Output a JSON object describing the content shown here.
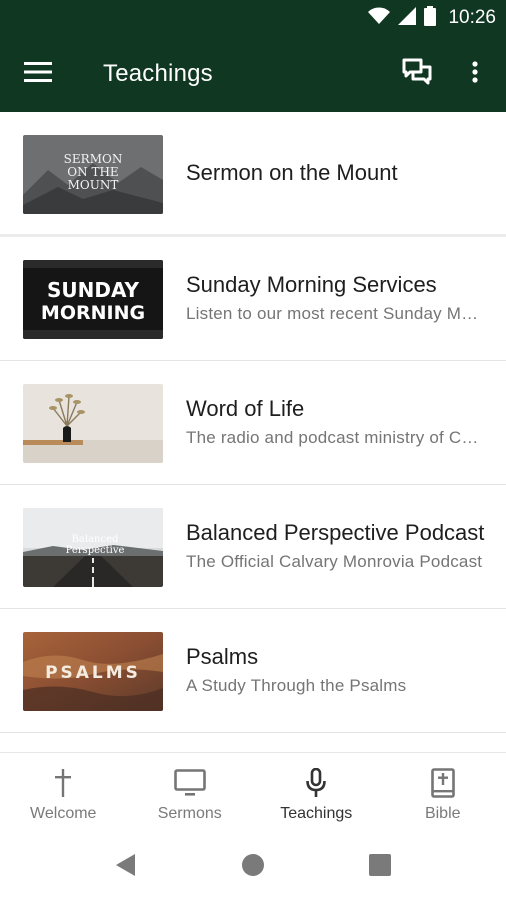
{
  "status_bar": {
    "time": "10:26"
  },
  "app_bar": {
    "title": "Teachings"
  },
  "items": [
    {
      "title": "Sermon on the Mount",
      "subtitle": "",
      "thumb_text": [
        "SERMON",
        "ON THE",
        "MOUNT"
      ]
    },
    {
      "title": "Sunday Morning Services",
      "subtitle": "Listen to our most recent Sunday Morning Services",
      "thumb_text": [
        "SUNDAY",
        "MORNING"
      ]
    },
    {
      "title": "Word of Life",
      "subtitle": "The radio and podcast ministry of Calvary Monrovia",
      "thumb_text": []
    },
    {
      "title": "Balanced Perspective Podcast",
      "subtitle": "The Official Calvary Monrovia Podcast",
      "thumb_text": [
        "Balanced",
        "Perspective"
      ]
    },
    {
      "title": "Psalms",
      "subtitle": "A Study Through the Psalms",
      "thumb_text": [
        "PSALMS"
      ]
    }
  ],
  "bottom_nav": [
    {
      "label": "Welcome",
      "icon": "cross-icon"
    },
    {
      "label": "Sermons",
      "icon": "monitor-icon"
    },
    {
      "label": "Teachings",
      "icon": "microphone-icon",
      "active": true
    },
    {
      "label": "Bible",
      "icon": "bible-icon"
    }
  ],
  "colors": {
    "app_bar": "#0f3721",
    "active_tab": "#333333",
    "inactive_tab": "#7a7a7a"
  }
}
